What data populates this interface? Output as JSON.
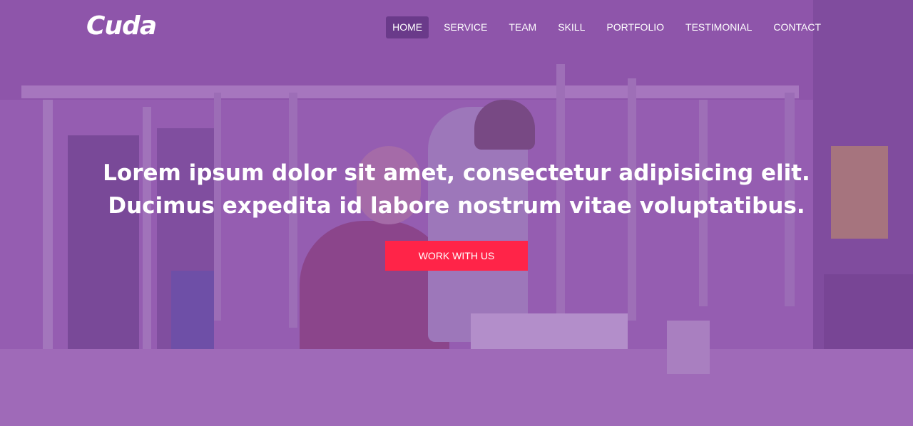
{
  "brand": {
    "logo_text": "Cuda"
  },
  "nav": {
    "items": [
      {
        "label": "HOME",
        "active": true
      },
      {
        "label": "SERVICE",
        "active": false
      },
      {
        "label": "TEAM",
        "active": false
      },
      {
        "label": "SKILL",
        "active": false
      },
      {
        "label": "PORTFOLIO",
        "active": false
      },
      {
        "label": "TESTIMONIAL",
        "active": false
      },
      {
        "label": "CONTACT",
        "active": false
      }
    ]
  },
  "hero": {
    "headline": "Lorem ipsum dolor sit amet, consectetur adipisicing elit. Ducimus expedita id labore nostrum vitae voluptatibus.",
    "cta_label": "WORK WITH US"
  },
  "colors": {
    "overlay": "#8a55a6",
    "nav_active_bg": "#6a3a8a",
    "cta_bg": "#ff2448",
    "text": "#ffffff"
  }
}
